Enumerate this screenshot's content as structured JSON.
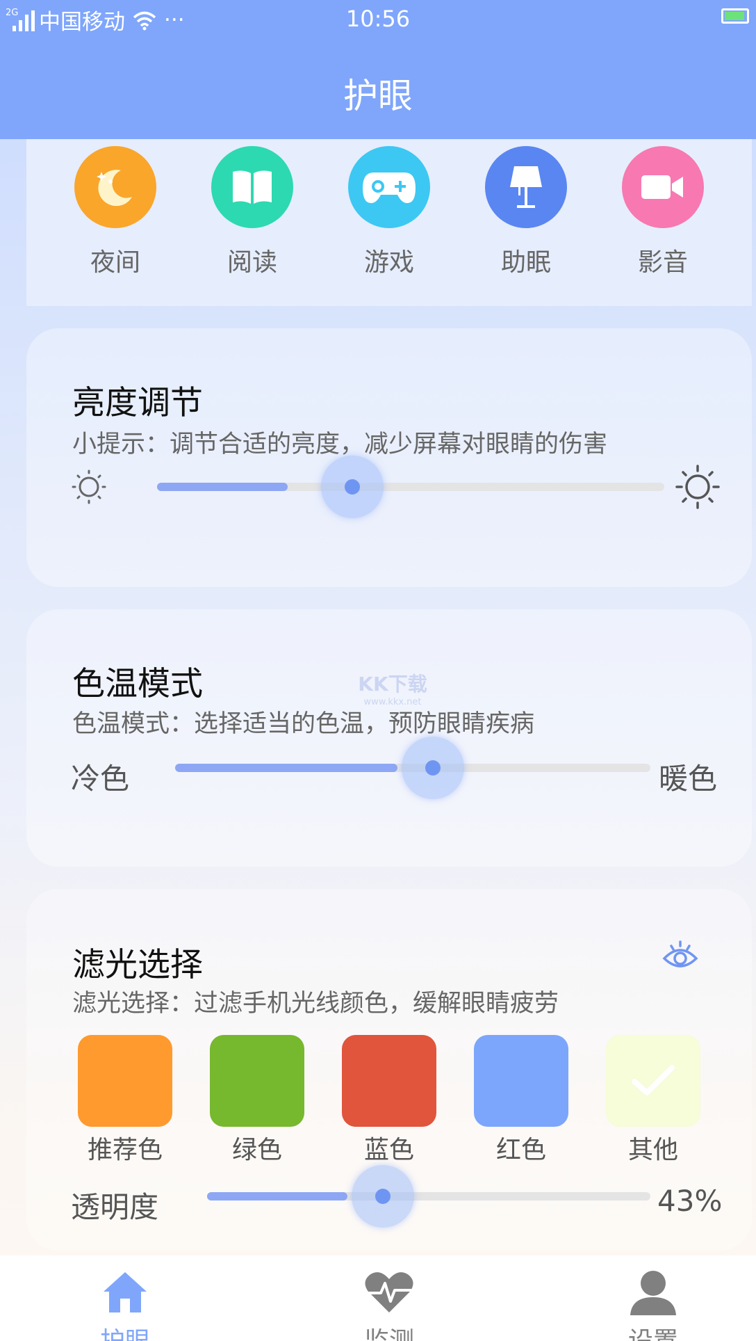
{
  "status_bar": {
    "network": "2G",
    "carrier": "中国移动",
    "more": "···",
    "time": "10:56"
  },
  "header": {
    "title": "护眼"
  },
  "modes": [
    {
      "label": "夜间",
      "icon": "moon-icon",
      "color": "#f9a62b"
    },
    {
      "label": "阅读",
      "icon": "book-icon",
      "color": "#2dd9b0"
    },
    {
      "label": "游戏",
      "icon": "gamepad-icon",
      "color": "#3cc8f2"
    },
    {
      "label": "助眠",
      "icon": "lamp-icon",
      "color": "#5a86f2"
    },
    {
      "label": "影音",
      "icon": "video-camera-icon",
      "color": "#f878b1"
    }
  ],
  "brightness": {
    "title": "亮度调节",
    "hint": "小提示：调节合适的亮度，减少屏幕对眼睛的伤害",
    "level": 0.35
  },
  "color_temp": {
    "title": "色温模式",
    "hint": "色温模式：选择适当的色温，预防眼睛疾病",
    "cold_label": "冷色",
    "warm_label": "暖色",
    "level": 0.55
  },
  "filter": {
    "title": "滤光选择",
    "hint": "滤光选择：过滤手机光线颜色，缓解眼睛疲劳",
    "swatches": [
      {
        "label": "推荐色",
        "color": "#ff9a2e"
      },
      {
        "label": "绿色",
        "color": "#76b82e"
      },
      {
        "label": "蓝色",
        "color": "#e0553c"
      },
      {
        "label": "红色",
        "color": "#7ca6fb"
      },
      {
        "label": "其他",
        "color": "#f7fcd9",
        "selected": true
      }
    ],
    "opacity_label": "透明度",
    "opacity_value": "43%",
    "opacity_level": 0.43
  },
  "watermark": {
    "text": "KK下载",
    "url": "www.kkx.net"
  },
  "bottom_nav": [
    {
      "label": "护眼",
      "icon": "home-icon",
      "active": true
    },
    {
      "label": "监测",
      "icon": "heart-monitor-icon",
      "active": false
    },
    {
      "label": "设置",
      "icon": "user-icon",
      "active": false
    }
  ],
  "colors": {
    "header": "#7fa6fb",
    "accent": "#7fa6fb",
    "slider_fill": "#8ea7f4",
    "nav_active": "#7fa6fb",
    "nav_inactive": "#808080"
  }
}
